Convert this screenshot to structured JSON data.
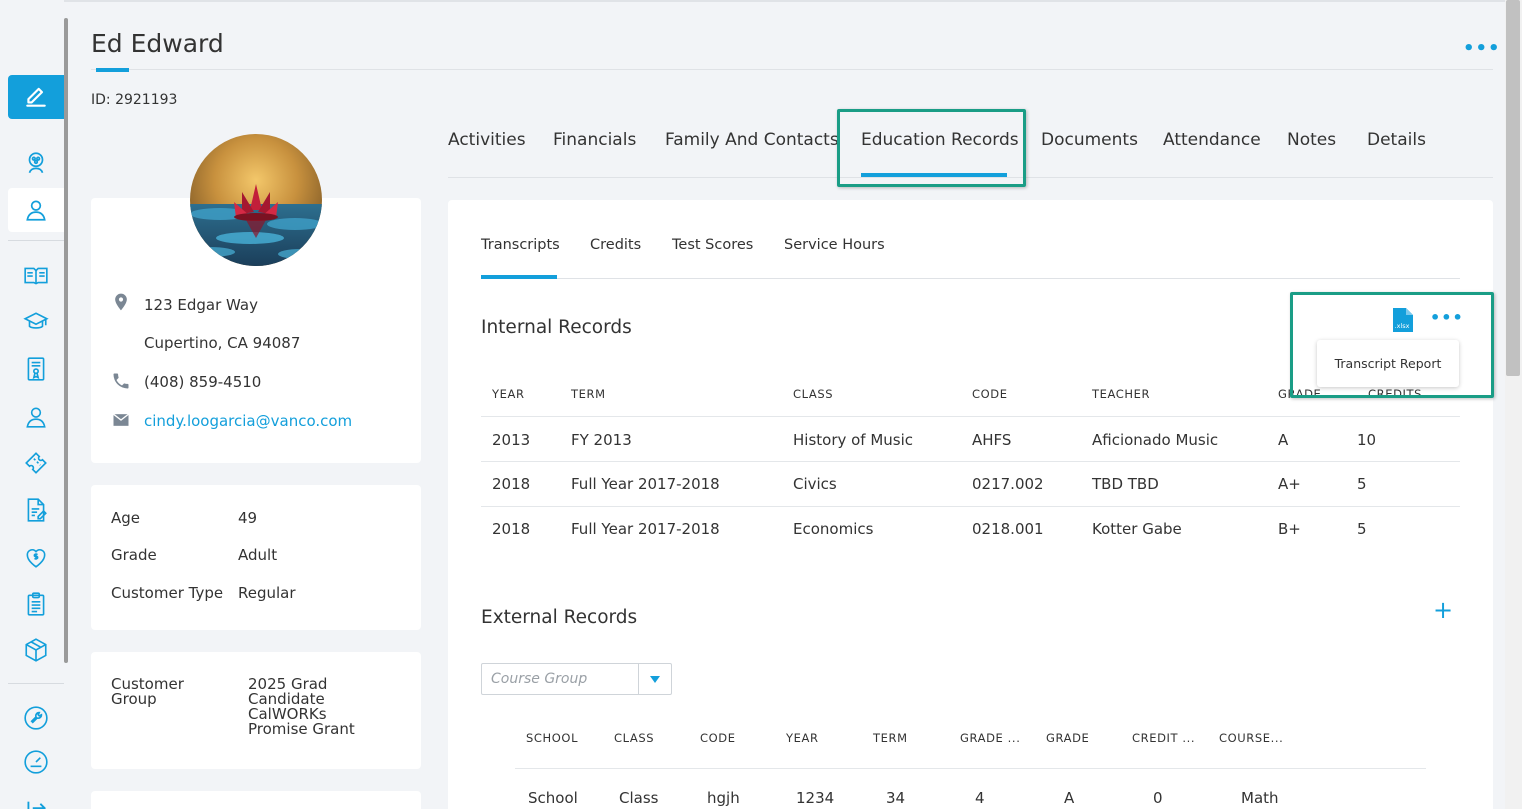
{
  "header": {
    "title": "Ed Edward",
    "id_text": "ID: 2921193",
    "more_label": "•••"
  },
  "sidebar": {
    "items": [
      {
        "name": "edit-icon"
      },
      {
        "name": "palette-icon"
      },
      {
        "name": "person-icon"
      },
      {
        "name": "book-icon"
      },
      {
        "name": "graduation-cap-icon"
      },
      {
        "name": "certificate-icon"
      },
      {
        "name": "user-icon"
      },
      {
        "name": "ticket-icon"
      },
      {
        "name": "document-edit-icon"
      },
      {
        "name": "heart-dollar-icon"
      },
      {
        "name": "clipboard-icon"
      },
      {
        "name": "package-icon"
      },
      {
        "name": "wrench-icon"
      },
      {
        "name": "speedometer-icon"
      },
      {
        "name": "logout-icon"
      }
    ]
  },
  "contact": {
    "address_line1": "123 Edgar Way",
    "address_line2": "Cupertino, CA 94087",
    "phone": "(408) 859-4510",
    "email": "cindy.loogarcia@vanco.com"
  },
  "profile": {
    "age_label": "Age",
    "age_value": "49",
    "grade_label": "Grade",
    "grade_value": "Adult",
    "type_label": "Customer Type",
    "type_value": "Regular",
    "group_label_1": "Customer",
    "group_label_2": "Group",
    "groups": [
      "2025 Grad",
      "Candidate",
      "CalWORKs",
      "Promise Grant"
    ]
  },
  "main_tabs": [
    "Activities",
    "Financials",
    "Family And Contacts",
    "Education Records",
    "Documents",
    "Attendance",
    "Notes",
    "Details"
  ],
  "sub_tabs": [
    "Transcripts",
    "Credits",
    "Test Scores",
    "Service Hours"
  ],
  "internal": {
    "title": "Internal Records",
    "more_label": "•••",
    "menu_item": "Transcript Report",
    "headers": [
      "YEAR",
      "TERM",
      "CLASS",
      "CODE",
      "TEACHER",
      "GRADE",
      "CREDITS"
    ],
    "rows": [
      [
        "2013",
        "FY 2013",
        "History of Music",
        "AHFS",
        "Aficionado Music",
        "A",
        "10"
      ],
      [
        "2018",
        "Full Year 2017-2018",
        "Civics",
        "0217.002",
        "TBD TBD",
        "A+",
        "5"
      ],
      [
        "2018",
        "Full Year 2017-2018",
        "Economics",
        "0218.001",
        "Kotter Gabe",
        "B+",
        "5"
      ]
    ]
  },
  "external": {
    "title": "External Records",
    "add_label": "+",
    "course_group_placeholder": "Course Group",
    "headers": [
      "SCHOOL",
      "CLASS",
      "CODE",
      "YEAR",
      "TERM",
      "GRADE ...",
      "GRADE",
      "CREDIT ...",
      "COURSE..."
    ],
    "rows": [
      [
        "School",
        "Class",
        "hgjh",
        "1234",
        "34",
        "4",
        "A",
        "0",
        "Math"
      ]
    ]
  },
  "colors": {
    "accent": "#139fdb",
    "highlight": "#1a9d86"
  }
}
